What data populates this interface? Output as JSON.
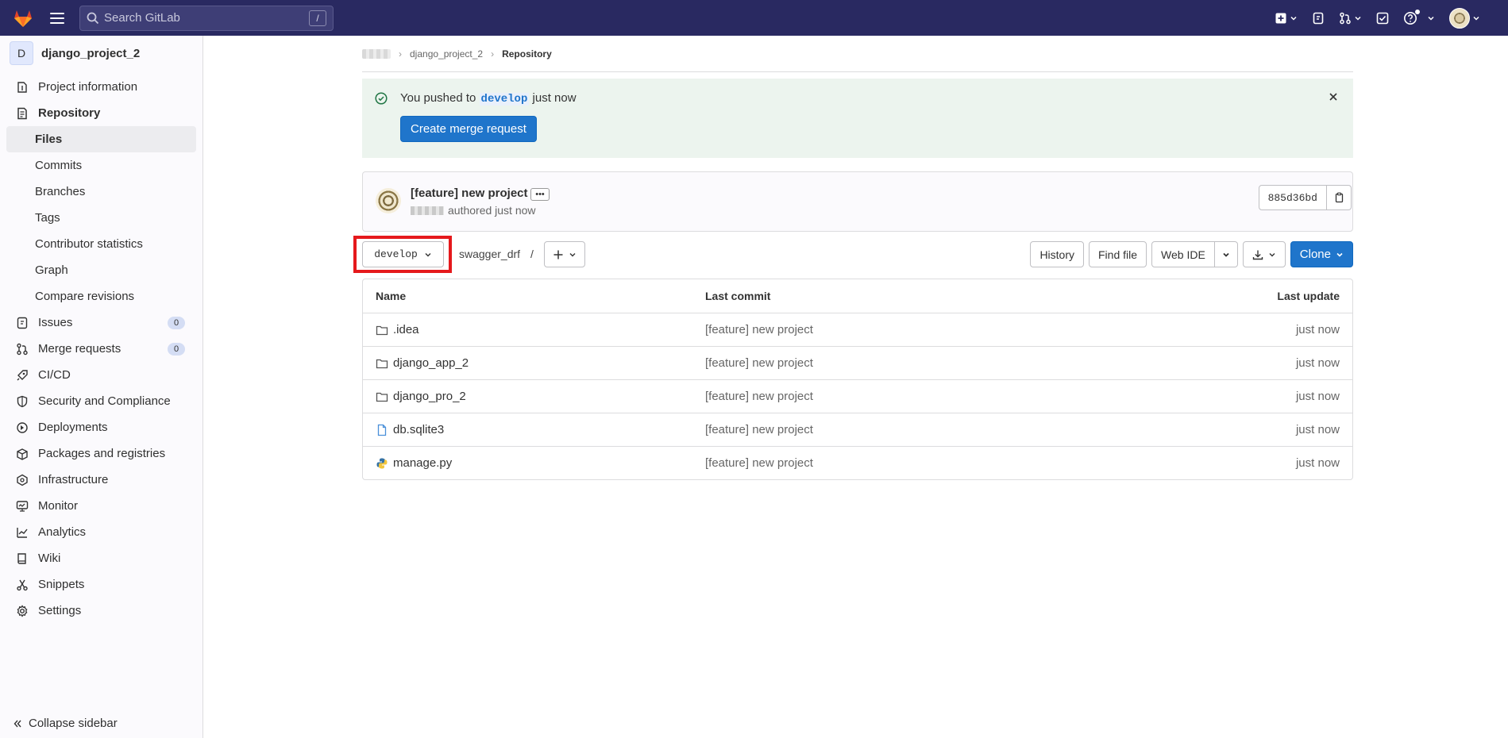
{
  "topbar": {
    "search_placeholder": "Search GitLab",
    "search_shortcut": "/"
  },
  "sidebar": {
    "project_initial": "D",
    "project_name": "django_project_2",
    "items": [
      {
        "label": "Project information",
        "icon": "project-info-icon"
      },
      {
        "label": "Repository",
        "icon": "repository-icon"
      },
      {
        "label": "Files"
      },
      {
        "label": "Commits"
      },
      {
        "label": "Branches"
      },
      {
        "label": "Tags"
      },
      {
        "label": "Contributor statistics"
      },
      {
        "label": "Graph"
      },
      {
        "label": "Compare revisions"
      },
      {
        "label": "Issues",
        "icon": "issues-icon",
        "count": "0"
      },
      {
        "label": "Merge requests",
        "icon": "merge-request-icon",
        "count": "0"
      },
      {
        "label": "CI/CD",
        "icon": "rocket-icon"
      },
      {
        "label": "Security and Compliance",
        "icon": "shield-icon"
      },
      {
        "label": "Deployments",
        "icon": "deployments-icon"
      },
      {
        "label": "Packages and registries",
        "icon": "package-icon"
      },
      {
        "label": "Infrastructure",
        "icon": "infrastructure-icon"
      },
      {
        "label": "Monitor",
        "icon": "monitor-icon"
      },
      {
        "label": "Analytics",
        "icon": "analytics-icon"
      },
      {
        "label": "Wiki",
        "icon": "book-icon"
      },
      {
        "label": "Snippets",
        "icon": "snippet-icon"
      },
      {
        "label": "Settings",
        "icon": "settings-icon"
      }
    ],
    "collapse_label": "Collapse sidebar"
  },
  "breadcrumb": {
    "project": "django_project_2",
    "current": "Repository"
  },
  "alert": {
    "prefix": "You pushed to ",
    "branch": "develop",
    "suffix": " just now",
    "button": "Create merge request"
  },
  "commit": {
    "title": "[feature] new project",
    "ellipsis": "•••",
    "authored": "authored just now",
    "sha": "885d36bd"
  },
  "toolbar": {
    "branch": "develop",
    "path": "swagger_drf",
    "path_sep": "/",
    "history": "History",
    "find_file": "Find file",
    "web_ide": "Web IDE",
    "clone": "Clone"
  },
  "files": {
    "headers": {
      "name": "Name",
      "commit": "Last commit",
      "date": "Last update"
    },
    "rows": [
      {
        "name": ".idea",
        "type": "folder",
        "commit": "[feature] new project",
        "date": "just now"
      },
      {
        "name": "django_app_2",
        "type": "folder",
        "commit": "[feature] new project",
        "date": "just now"
      },
      {
        "name": "django_pro_2",
        "type": "folder",
        "commit": "[feature] new project",
        "date": "just now"
      },
      {
        "name": "db.sqlite3",
        "type": "file",
        "commit": "[feature] new project",
        "date": "just now"
      },
      {
        "name": "manage.py",
        "type": "python",
        "commit": "[feature] new project",
        "date": "just now"
      }
    ]
  },
  "colors": {
    "topbar": "#292961",
    "primary": "#1f75cb",
    "highlight": "#e5191c",
    "alert_bg": "#ecf4ee"
  }
}
